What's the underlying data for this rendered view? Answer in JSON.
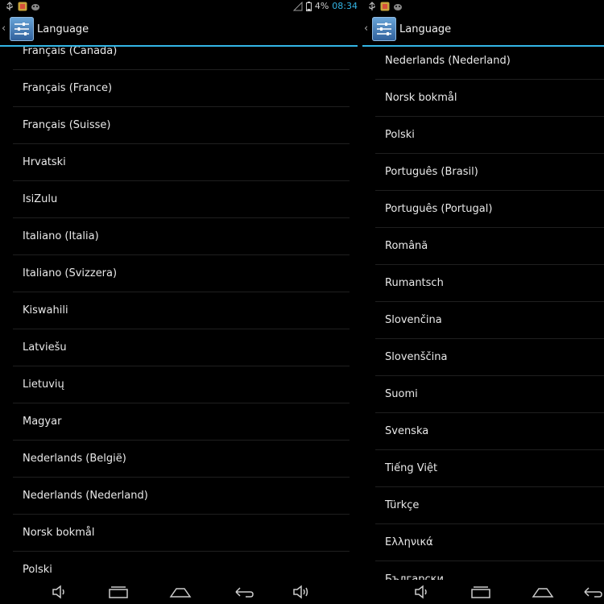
{
  "status_bar": {
    "battery_text": "4%",
    "time": "08:34",
    "icons": [
      "usb-icon",
      "gallery-notification-icon",
      "android-notification-icon",
      "signal-icon",
      "battery-icon"
    ]
  },
  "left": {
    "action_bar": {
      "title": "Language",
      "icon": "settings-icon",
      "back": "‹"
    },
    "items": [
      "Français (Canada)",
      "Français (France)",
      "Français (Suisse)",
      "Hrvatski",
      "IsiZulu",
      "Italiano (Italia)",
      "Italiano (Svizzera)",
      "Kiswahili",
      "Latviešu",
      "Lietuvių",
      "Magyar",
      "Nederlands (België)",
      "Nederlands (Nederland)",
      "Norsk bokmål",
      "Polski"
    ]
  },
  "right": {
    "action_bar": {
      "title": "Language",
      "icon": "settings-icon",
      "back": "‹"
    },
    "items": [
      "Nederlands (Nederland)",
      "Norsk bokmål",
      "Polski",
      "Português (Brasil)",
      "Português (Portugal)",
      "Română",
      "Rumantsch",
      "Slovenčina",
      "Slovenščina",
      "Suomi",
      "Svenska",
      "Tiếng Việt",
      "Türkçe",
      "Ελληνικά",
      "Български"
    ]
  },
  "nav_bar": {
    "buttons": [
      "volume-down-icon",
      "recent-apps-icon",
      "home-icon",
      "back-icon",
      "volume-up-icon"
    ]
  }
}
